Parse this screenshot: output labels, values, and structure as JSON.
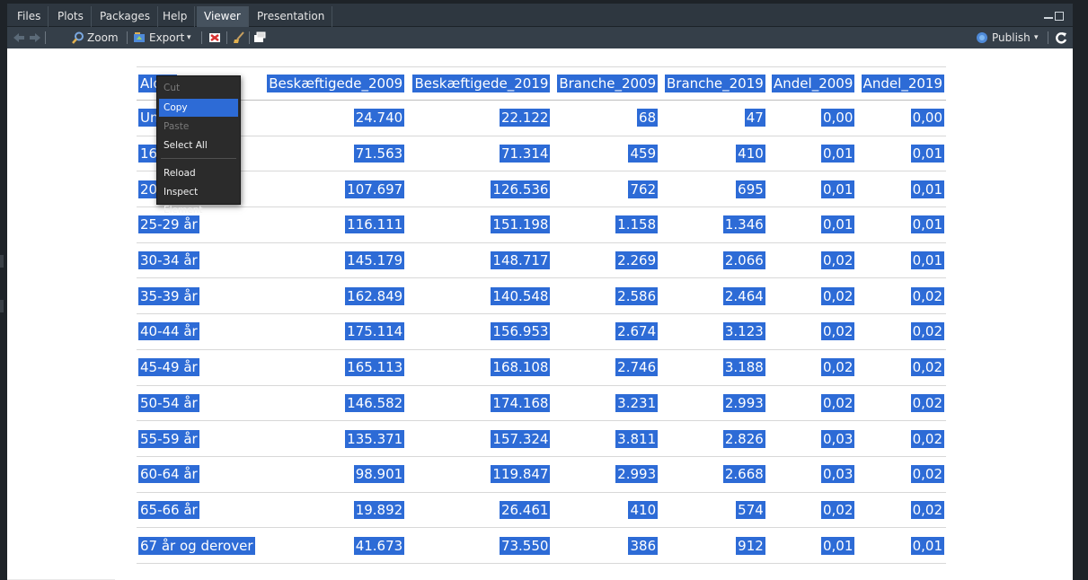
{
  "tabs": [
    {
      "label": "Files"
    },
    {
      "label": "Plots"
    },
    {
      "label": "Packages"
    },
    {
      "label": "Help"
    },
    {
      "label": "Viewer"
    },
    {
      "label": "Presentation"
    }
  ],
  "active_tab": "Viewer",
  "toolbar": {
    "zoom_label": "Zoom",
    "export_label": "Export",
    "publish_label": "Publish",
    "dropdown_glyph": "▾",
    "accent_color": "#2d6bd6"
  },
  "table": {
    "headers": [
      "Alder",
      "Beskæftigede_2009",
      "Beskæftigede_2019",
      "Branche_2009",
      "Branche_2019",
      "Andel_2009",
      "Andel_2019"
    ],
    "rows": [
      [
        "Under 16 år",
        "24.740",
        "22.122",
        "68",
        "47",
        "0,00",
        "0,00"
      ],
      [
        "16-19 år",
        "71.563",
        "71.314",
        "459",
        "410",
        "0,01",
        "0,01"
      ],
      [
        "20-24 år",
        "107.697",
        "126.536",
        "762",
        "695",
        "0,01",
        "0,01"
      ],
      [
        "25-29 år",
        "116.111",
        "151.198",
        "1.158",
        "1.346",
        "0,01",
        "0,01"
      ],
      [
        "30-34 år",
        "145.179",
        "148.717",
        "2.269",
        "2.066",
        "0,02",
        "0,01"
      ],
      [
        "35-39 år",
        "162.849",
        "140.548",
        "2.586",
        "2.464",
        "0,02",
        "0,02"
      ],
      [
        "40-44 år",
        "175.114",
        "156.953",
        "2.674",
        "3.123",
        "0,02",
        "0,02"
      ],
      [
        "45-49 år",
        "165.113",
        "168.108",
        "2.746",
        "3.188",
        "0,02",
        "0,02"
      ],
      [
        "50-54 år",
        "146.582",
        "174.168",
        "3.231",
        "2.993",
        "0,02",
        "0,02"
      ],
      [
        "55-59 år",
        "135.371",
        "157.324",
        "3.811",
        "2.826",
        "0,03",
        "0,02"
      ],
      [
        "60-64 år",
        "98.901",
        "119.847",
        "2.993",
        "2.668",
        "0,03",
        "0,02"
      ],
      [
        "65-66 år",
        "19.892",
        "26.461",
        "410",
        "574",
        "0,02",
        "0,02"
      ],
      [
        "67 år og derover",
        "41.673",
        "73.550",
        "386",
        "912",
        "0,01",
        "0,01"
      ]
    ]
  },
  "context_menu": {
    "items": [
      {
        "label": "Cut",
        "enabled": false
      },
      {
        "label": "Copy",
        "enabled": true,
        "highlighted": true
      },
      {
        "label": "Paste",
        "enabled": false
      },
      {
        "label": "Select All",
        "enabled": true
      },
      {
        "label": "Reload",
        "enabled": true
      },
      {
        "label": "Inspect Element",
        "enabled": true
      }
    ]
  },
  "selection_color": "#2d6bd6"
}
